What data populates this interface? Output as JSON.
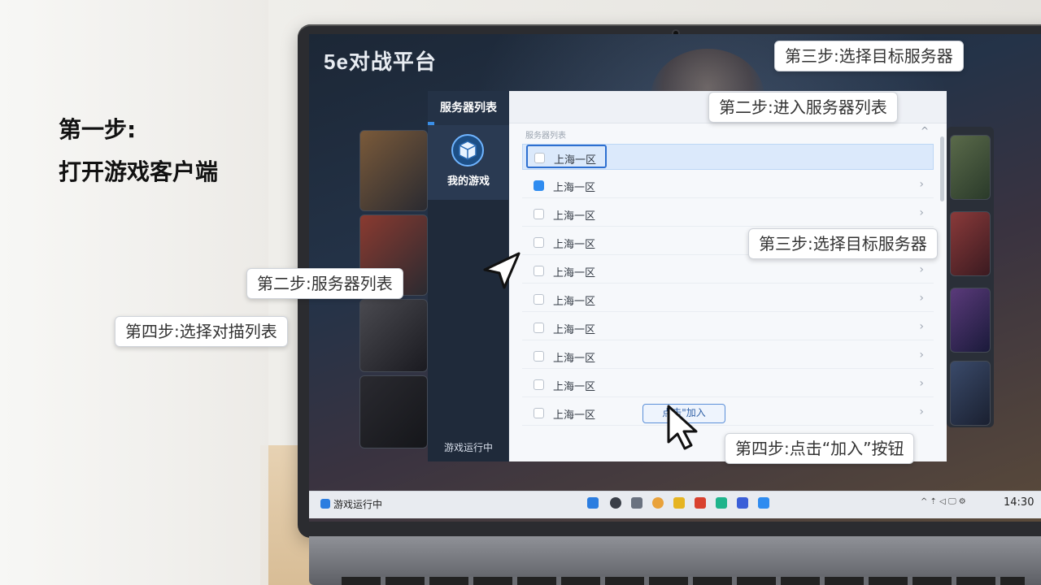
{
  "intro": {
    "line1": "第一步:",
    "line2": "打开游戏客户端"
  },
  "app": {
    "brand": "5e对战平台",
    "sidebar": {
      "title": "服务器列表",
      "my_games": "我的游戏",
      "status": "游戏运行中"
    },
    "list": {
      "header": "服务器列表",
      "collapse_glyph": "^",
      "rows": [
        {
          "label": "上海一区",
          "checked": false,
          "selected": true
        },
        {
          "label": "上海一区",
          "checked": true,
          "selected": false
        },
        {
          "label": "上海一区",
          "checked": false,
          "selected": false
        },
        {
          "label": "上海一区",
          "checked": false,
          "selected": false
        },
        {
          "label": "上海一区",
          "checked": false,
          "selected": false
        },
        {
          "label": "上海一区",
          "checked": false,
          "selected": false
        },
        {
          "label": "上海一区",
          "checked": false,
          "selected": false
        },
        {
          "label": "上海一区",
          "checked": false,
          "selected": false
        },
        {
          "label": "上海一区",
          "checked": false,
          "selected": false
        },
        {
          "label": "上海一区",
          "checked": false,
          "selected": false
        }
      ],
      "row_arrow": "›",
      "join_button": "点击\"加入"
    }
  },
  "taskbar": {
    "app_label": "游戏运行中",
    "tray": "^ ⇡ ◁ 🖵 ⚙",
    "clock": "14:30"
  },
  "callouts": {
    "top_right": "第三步:选择目标服务器",
    "second_step_top": "第二步:进入服务器列表",
    "third_step_mid": "第三步:选择目标服务器",
    "second_step_left": "第二步:服务器列表",
    "fourth_step_left": "第四步:选择对描列表",
    "fourth_step_bottom": "第四步:点击“加入”按钮"
  },
  "colors": {
    "accent": "#2f8cf0",
    "sidebar_bg": "#1f2a3a",
    "callout_bg": "#ffffff"
  }
}
